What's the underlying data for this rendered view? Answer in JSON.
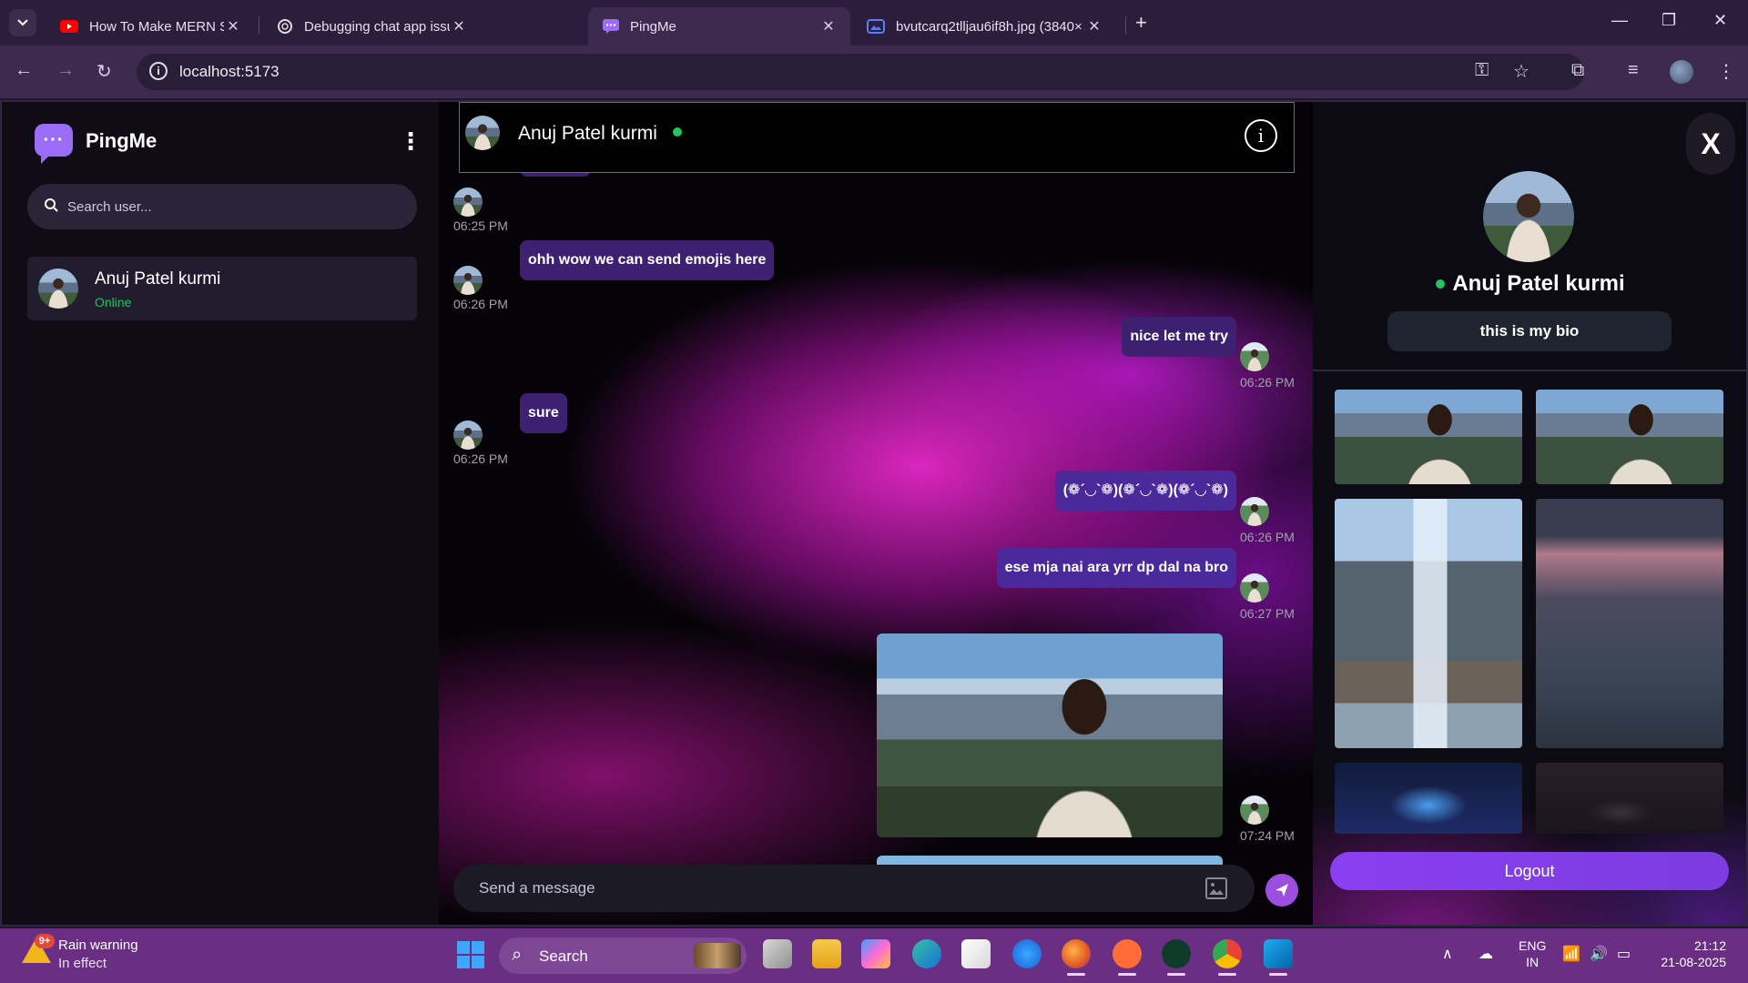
{
  "browser": {
    "tabs": [
      {
        "title": "How To Make MERN Stack Chat",
        "icon": "youtube-icon",
        "active": false
      },
      {
        "title": "Debugging chat app issues",
        "icon": "chatgpt-icon",
        "active": false
      },
      {
        "title": "PingMe",
        "icon": "pingme-icon",
        "active": true
      },
      {
        "title": "bvutcarq2tlljau6if8h.jpg (3840×",
        "icon": "image-icon",
        "active": false
      }
    ],
    "url": "localhost:5173"
  },
  "sidebar": {
    "brand": "PingMe",
    "search_placeholder": "Search user...",
    "contacts": [
      {
        "name": "Anuj Patel kurmi",
        "status": "Online"
      }
    ]
  },
  "chat": {
    "header_name": "Anuj Patel kurmi",
    "messages": [
      {
        "text": "🤬🤬🤬",
        "time": "06:25 PM",
        "side": "left"
      },
      {
        "text": "ohh wow we can send emojis here",
        "time": "06:26 PM",
        "side": "left"
      },
      {
        "text": "nice let me try",
        "time": "06:26 PM",
        "side": "right"
      },
      {
        "text": "sure",
        "time": "06:26 PM",
        "side": "left"
      },
      {
        "text": "(❁´◡`❁)(❁´◡`❁)(❁´◡`❁)",
        "time": "06:26 PM",
        "side": "right"
      },
      {
        "text": "ese mja nai ara yrr dp dal na bro",
        "time": "06:27 PM",
        "side": "right"
      },
      {
        "text": "",
        "time": "07:24 PM",
        "side": "right",
        "kind": "image"
      }
    ],
    "composer_placeholder": "Send a message"
  },
  "profile": {
    "close_label": "X",
    "name": "Anuj Patel kurmi",
    "bio": "this is my bio",
    "logout_label": "Logout"
  },
  "taskbar": {
    "weather_title": "Rain warning",
    "weather_sub": "In effect",
    "weather_badge": "9+",
    "search_label": "Search",
    "lang_top": "ENG",
    "lang_bottom": "IN",
    "time": "21:12",
    "date": "21-08-2025"
  },
  "colors": {
    "accent": "#9b6cf5",
    "online": "#22c55e",
    "bubble": "#3e2070",
    "taskbar": "#6a2f82"
  }
}
